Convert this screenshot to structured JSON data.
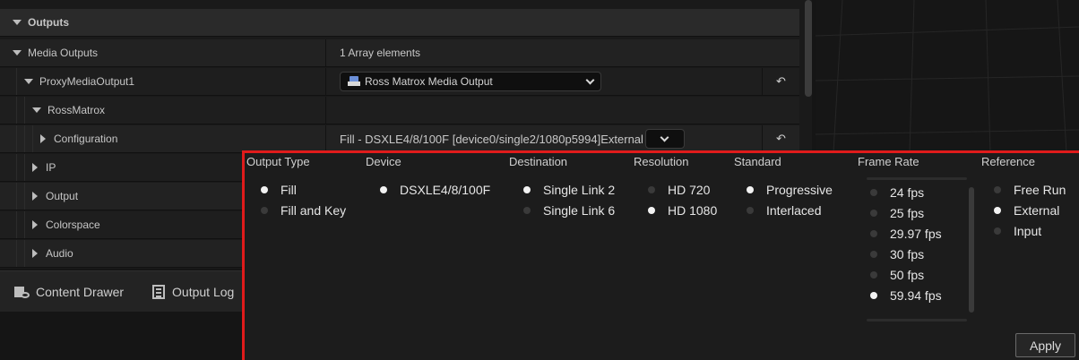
{
  "details": {
    "rows": [
      {
        "label": "Outputs",
        "value": ""
      },
      {
        "label": "Media Outputs",
        "value": "1 Array elements"
      },
      {
        "label": "ProxyMediaOutput1",
        "value": "Ross Matrox Media Output"
      },
      {
        "label": "RossMatrox",
        "value": ""
      },
      {
        "label": "Configuration",
        "value": "Fill - DSXLE4/8/100F [device0/single2/1080p5994]External"
      },
      {
        "label": "IP",
        "value": ""
      },
      {
        "label": "Output",
        "value": ""
      },
      {
        "label": "Colorspace",
        "value": ""
      },
      {
        "label": "Audio",
        "value": ""
      }
    ],
    "reset_glyph": "↶"
  },
  "drawer": {
    "content_drawer_label": "Content Drawer",
    "output_log_label": "Output Log"
  },
  "popup": {
    "headers": [
      "Output Type",
      "Device",
      "Destination",
      "Resolution",
      "Standard",
      "Frame Rate",
      "Reference"
    ],
    "output_type": [
      {
        "label": "Fill",
        "selected": true
      },
      {
        "label": "Fill and Key",
        "selected": false
      }
    ],
    "device": [
      {
        "label": "DSXLE4/8/100F",
        "selected": true
      }
    ],
    "destination": [
      {
        "label": "Single Link 2",
        "selected": true
      },
      {
        "label": "Single Link 6",
        "selected": false
      }
    ],
    "resolution": [
      {
        "label": "HD 720",
        "selected": false
      },
      {
        "label": "HD 1080",
        "selected": true
      }
    ],
    "standard": [
      {
        "label": "Progressive",
        "selected": true
      },
      {
        "label": "Interlaced",
        "selected": false
      }
    ],
    "frame_rate": [
      {
        "label": "24 fps",
        "selected": false
      },
      {
        "label": "25 fps",
        "selected": false
      },
      {
        "label": "29.97 fps",
        "selected": false
      },
      {
        "label": "30 fps",
        "selected": false
      },
      {
        "label": "50 fps",
        "selected": false
      },
      {
        "label": "59.94 fps",
        "selected": true
      }
    ],
    "reference": [
      {
        "label": "Free Run",
        "selected": false
      },
      {
        "label": "External",
        "selected": true
      },
      {
        "label": "Input",
        "selected": false
      }
    ],
    "apply_label": "Apply"
  },
  "colors": {
    "highlight_border": "#e01b1b",
    "selected_dot": "#f2f2f2",
    "unselected_dot": "#3a3a3a"
  }
}
